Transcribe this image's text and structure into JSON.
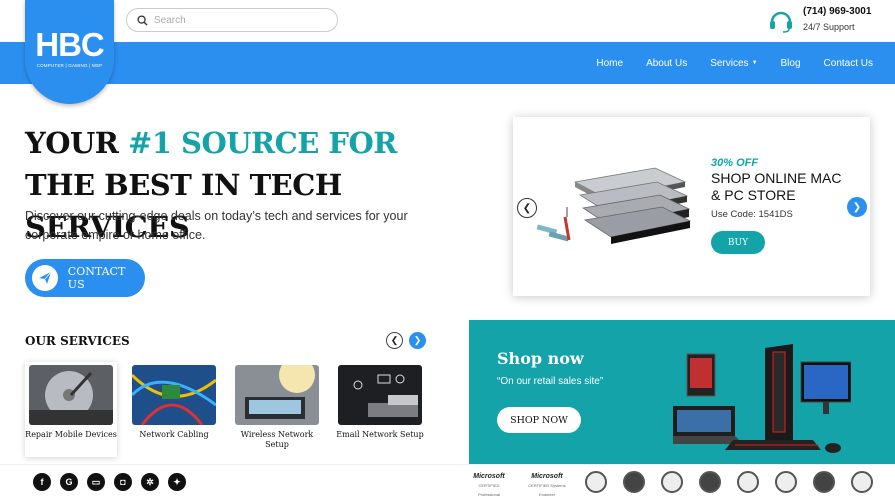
{
  "header": {
    "logo_text": "HBC",
    "logo_tagline": "COMPUTER | GAMING | MSP",
    "search_placeholder": "Search",
    "phone": "(714) 969-3001",
    "support_label": "24/7 Support"
  },
  "nav": {
    "items": [
      "Home",
      "About Us",
      "Services",
      "Blog",
      "Contact Us"
    ]
  },
  "hero": {
    "title_part1": "YOUR ",
    "title_accent": "#1 SOURCE FOR",
    "title_part2": " THE BEST IN TECH SERVICES",
    "description": "Discover our cutting-edge deals on today’s tech and services for your corporate empire or home office.",
    "cta_label": "CONTACT US"
  },
  "promo": {
    "discount": "30% OFF",
    "headline": "SHOP ONLINE MAC & PC STORE",
    "code": "Use Code: 1541DS",
    "button": "BUY"
  },
  "services": {
    "title": "OUR SERVICES",
    "items": [
      {
        "label": "Repair Mobile Devices"
      },
      {
        "label": "Network Cabling"
      },
      {
        "label": "Wireless Network Setup"
      },
      {
        "label": "Email Network Setup"
      }
    ]
  },
  "shop": {
    "title": "Shop now",
    "subtitle": "“On our retail sales site”",
    "button": "SHOP NOW"
  },
  "footer": {
    "social": [
      "facebook-icon",
      "google-icon",
      "chat-icon",
      "instagram-icon",
      "yelp-icon",
      "twitter-icon"
    ],
    "microsoft_1": "Microsoft",
    "microsoft_1_sub": "CERTIFIED Professional",
    "microsoft_2": "Microsoft",
    "microsoft_2_sub": "CERTIFIED Systems Engineer"
  },
  "colors": {
    "primary": "#2b8ff0",
    "accent": "#13a3a8"
  }
}
